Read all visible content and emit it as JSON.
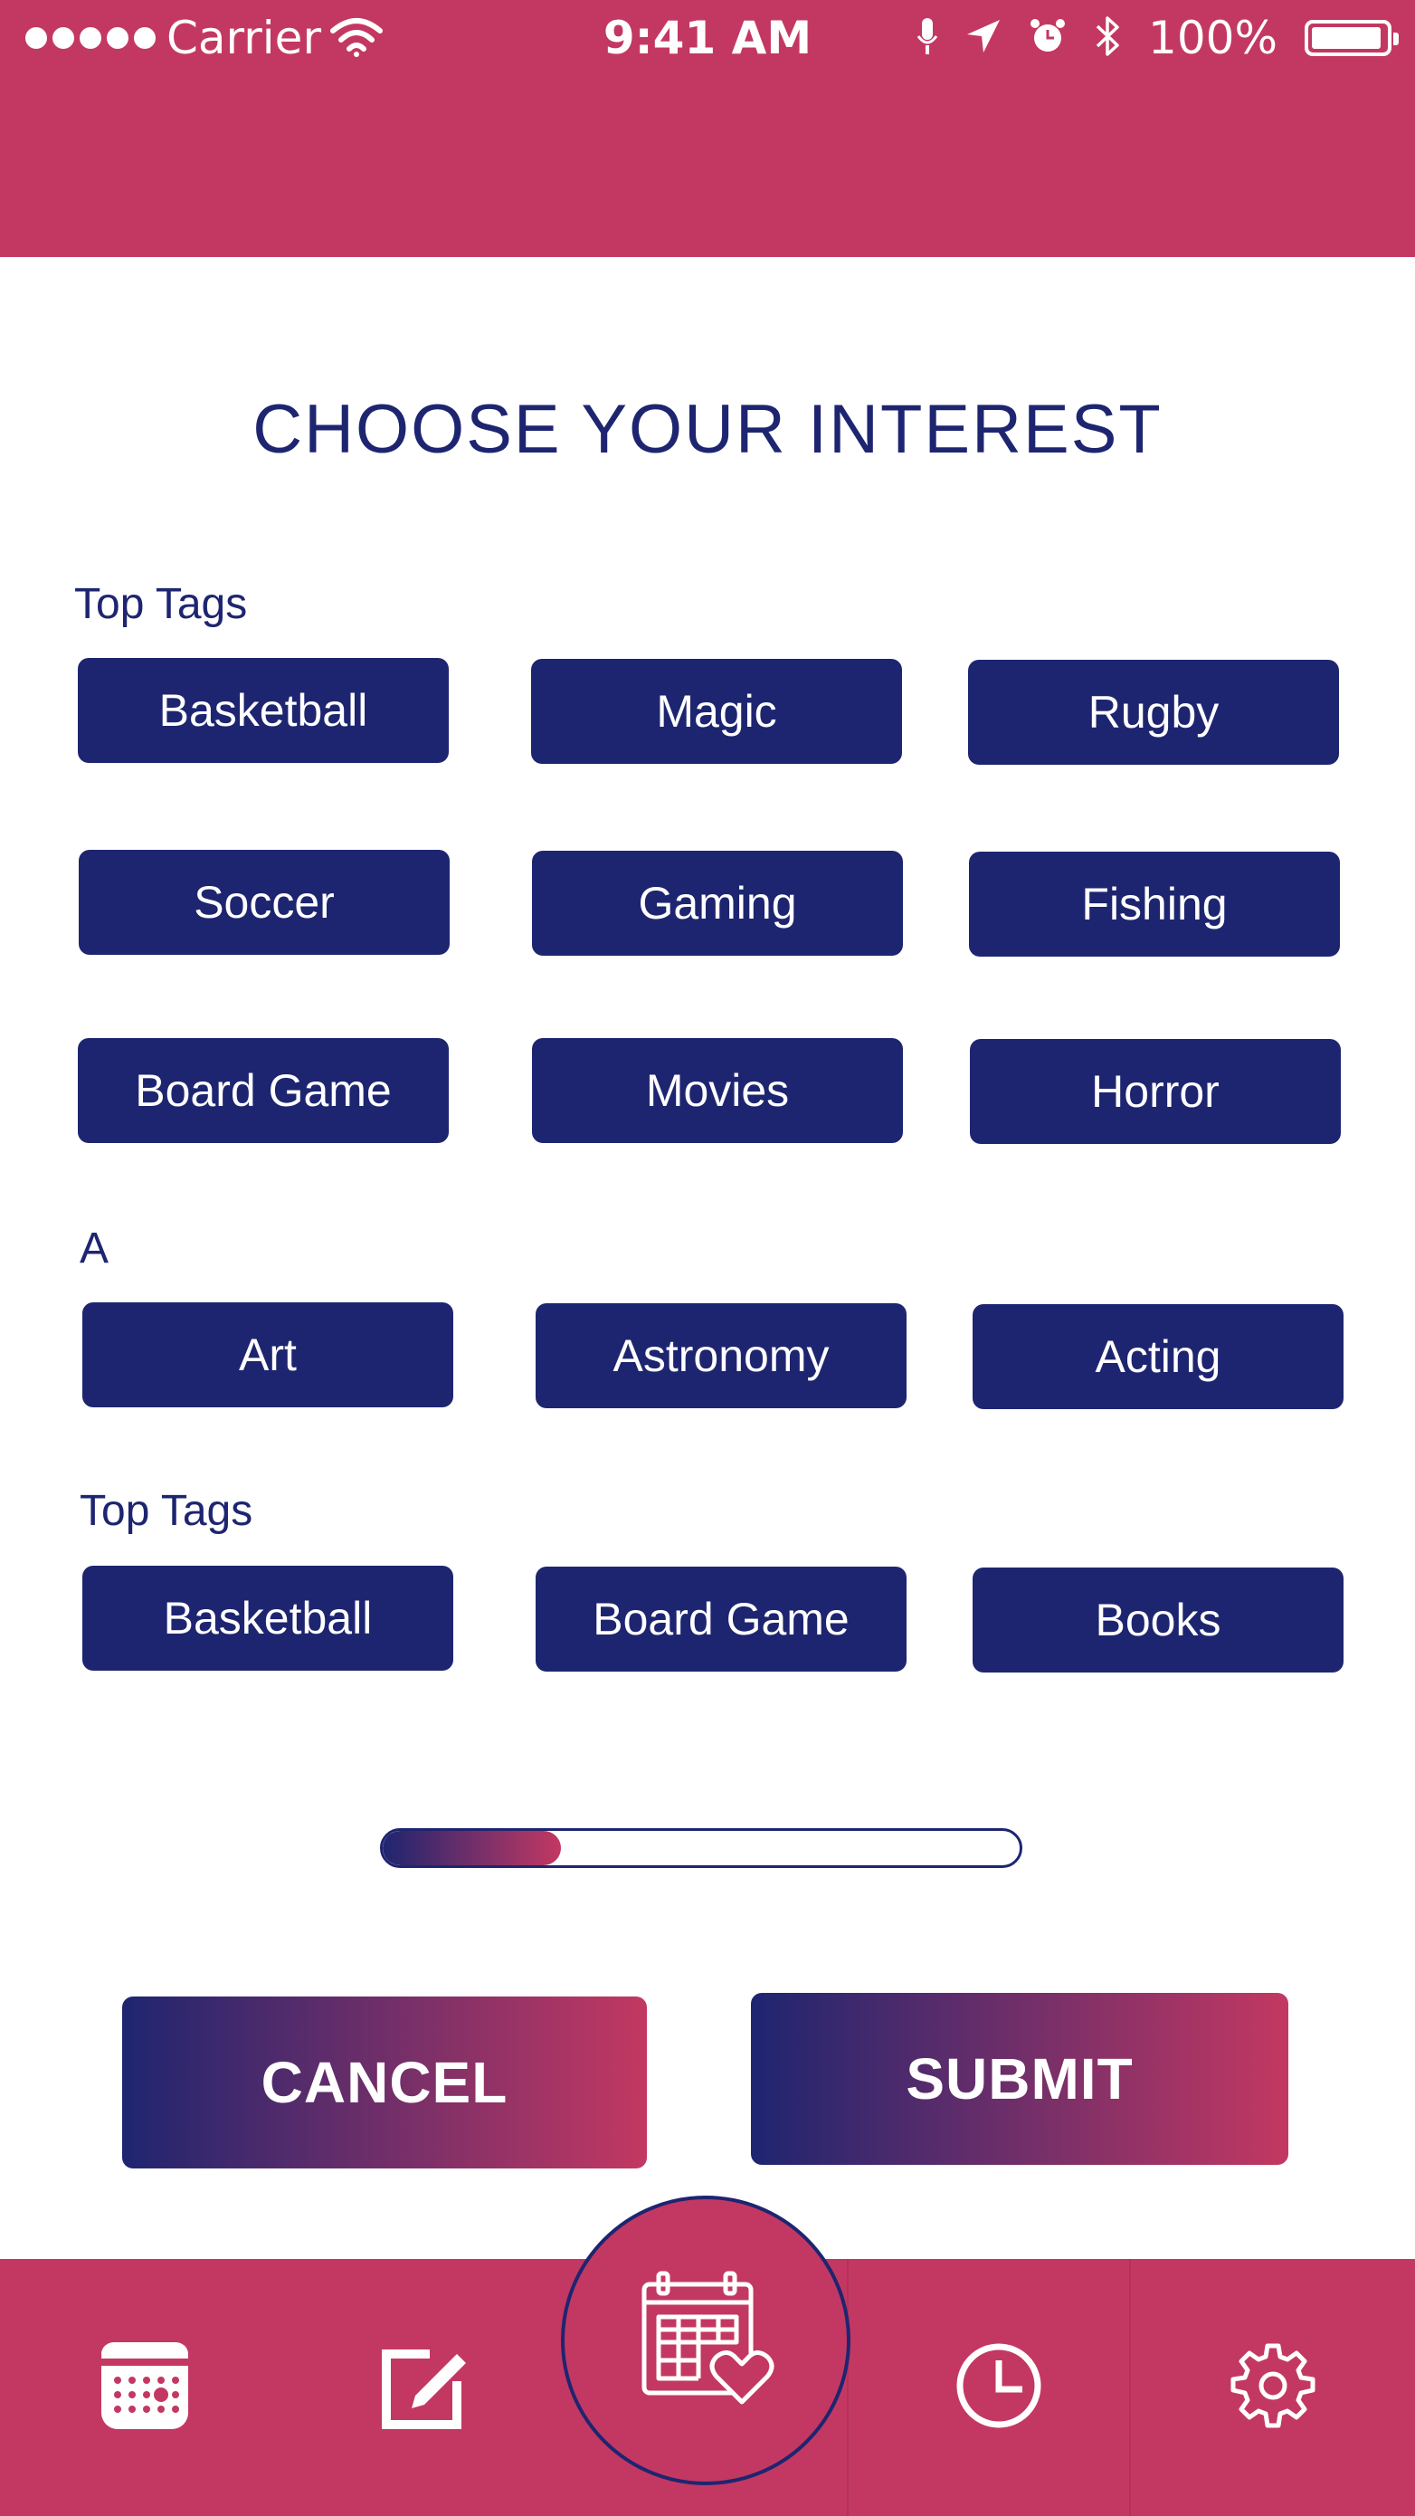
{
  "status_bar": {
    "carrier": "Carrier",
    "time": "9:41 AM",
    "battery": "100%"
  },
  "page": {
    "title": "CHOOSE YOUR INTEREST"
  },
  "sections": [
    {
      "label": "Top Tags",
      "tags": [
        "Basketball",
        "Magic",
        "Rugby",
        "Soccer",
        "Gaming",
        "Fishing",
        "Board Game",
        "Movies",
        "Horror"
      ]
    },
    {
      "label": "A",
      "tags": [
        "Art",
        "Astronomy",
        "Acting"
      ]
    },
    {
      "label": "Top Tags",
      "tags": [
        "Basketball",
        "Board Game",
        "Books"
      ]
    }
  ],
  "progress": {
    "fraction": 0.28
  },
  "actions": {
    "cancel": "CANCEL",
    "submit": "SUBMIT"
  },
  "nav": {
    "items": [
      "calendar-icon",
      "edit-icon",
      "calendar-heart-icon",
      "clock-icon",
      "gear-icon"
    ]
  },
  "colors": {
    "primary": "#1e2570",
    "accent": "#c33862",
    "background": "#ffffff"
  }
}
